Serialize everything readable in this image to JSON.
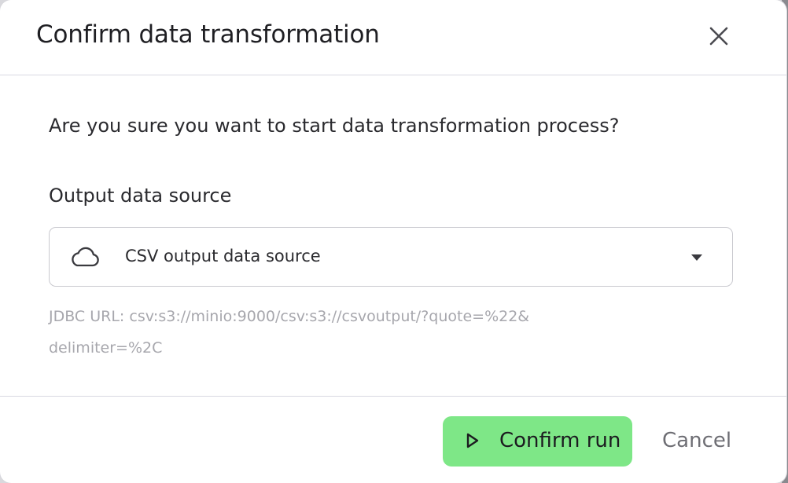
{
  "dialog": {
    "title": "Confirm data transformation",
    "close_icon": "close-icon"
  },
  "body": {
    "question": "Are you sure you want to start data transformation process?",
    "output_label": "Output data source",
    "select": {
      "icon": "cloud-icon",
      "value": "CSV output data source",
      "caret_icon": "caret-down-icon"
    },
    "hint": "JDBC URL: csv:s3://minio:9000/csv:s3://csvoutput/?quote=%22&delimiter=%2C"
  },
  "footer": {
    "confirm_label": "Confirm run",
    "confirm_icon": "play-icon",
    "cancel_label": "Cancel",
    "confirm_color": "#7ee787"
  }
}
